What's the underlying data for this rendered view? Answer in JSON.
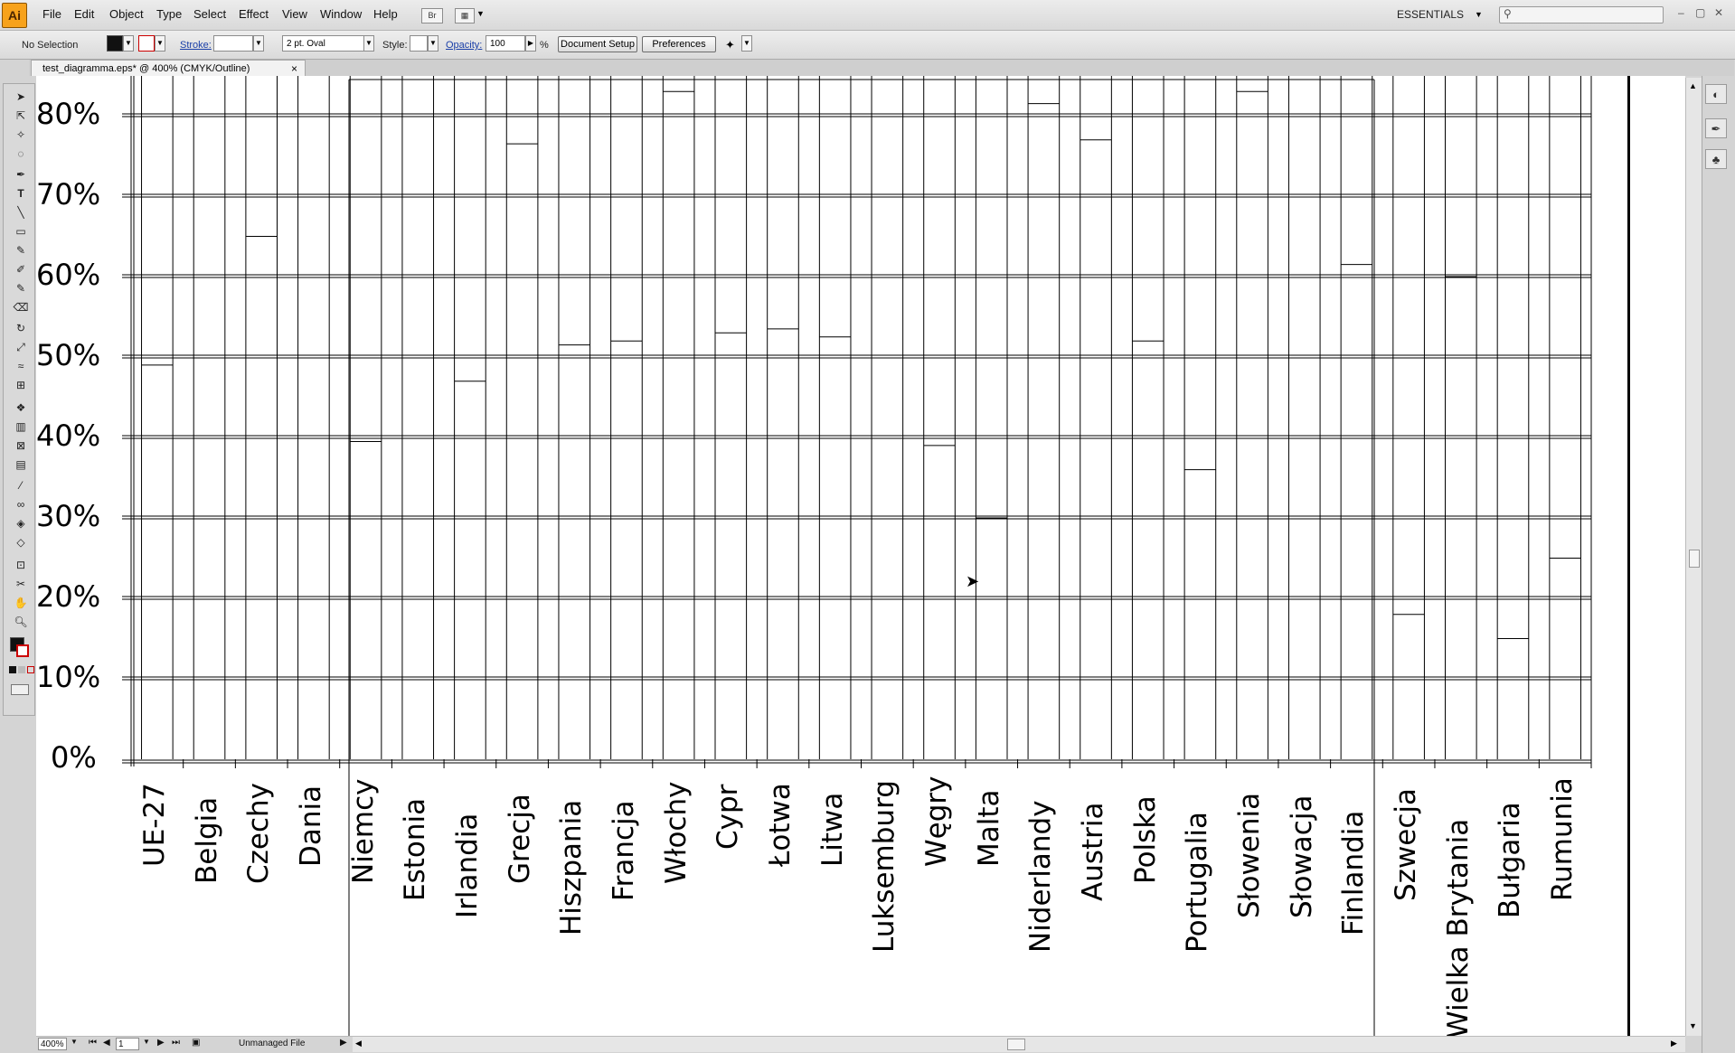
{
  "app": {
    "logo": "Ai",
    "menu": [
      "File",
      "Edit",
      "Object",
      "Type",
      "Select",
      "Effect",
      "View",
      "Window",
      "Help"
    ],
    "bridge_label": "Br",
    "workspace": "ESSENTIALS"
  },
  "control_bar": {
    "selection": "No Selection",
    "stroke_label": "Stroke:",
    "brush": "2 pt. Oval",
    "style_label": "Style:",
    "opacity_label": "Opacity:",
    "opacity_value": "100",
    "percent": "%",
    "document_setup": "Document Setup",
    "preferences": "Preferences"
  },
  "document": {
    "tab_title": "test_diagramma.eps* @ 400% (CMYK/Outline)",
    "close": "×"
  },
  "chart_data": {
    "type": "bar",
    "y_ticks": [
      "80%",
      "70%",
      "60%",
      "50%",
      "40%",
      "30%",
      "20%",
      "10%",
      "0%"
    ],
    "ylim": [
      0,
      85
    ],
    "categories": [
      "UE-27",
      "Belgia",
      "Czechy",
      "Dania",
      "Niemcy",
      "Estonia",
      "Irlandia",
      "Grecja",
      "Hiszpania",
      "Francja",
      "Włochy",
      "Cypr",
      "Łotwa",
      "Litwa",
      "Luksemburg",
      "Węgry",
      "Malta",
      "Niderlandy",
      "Austria",
      "Polska",
      "Portugalia",
      "Słowenia",
      "Słowacja",
      "Finlandia",
      "Szwecja",
      "Wielka Brytania",
      "Bułgaria",
      "Rumunia"
    ],
    "values": [
      49,
      null,
      65,
      null,
      39.5,
      85,
      47,
      76.5,
      51.5,
      52,
      83,
      53,
      53.5,
      52.5,
      null,
      39,
      30,
      81.5,
      77,
      52,
      36,
      83,
      null,
      61.5,
      18,
      60,
      15,
      25
    ]
  },
  "status": {
    "zoom": "400%",
    "page": "1",
    "file_status": "Unmanaged File"
  }
}
